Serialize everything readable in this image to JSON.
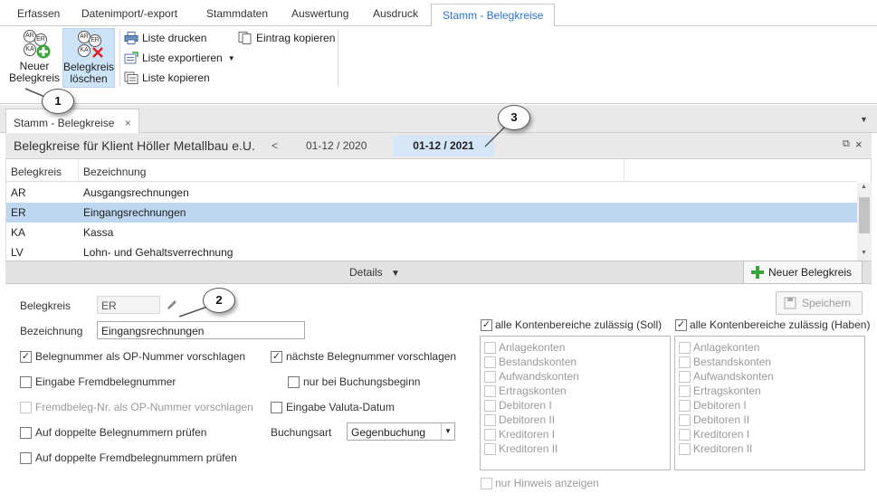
{
  "ribbon": {
    "tabs": [
      "Erfassen",
      "Datenimport/-export",
      "Stammdaten",
      "Auswertung",
      "Ausdruck",
      "Stamm - Belegkreise"
    ],
    "new_line1": "Neuer",
    "new_line2": "Belegkreis",
    "del_line1": "Belegkreis",
    "del_line2": "löschen",
    "icon_labels": [
      "AR",
      "ER",
      "KA"
    ],
    "print_list": "Liste drucken",
    "export_list": "Liste exportieren",
    "copy_list": "Liste kopieren",
    "copy_entry": "Eintrag kopieren"
  },
  "callouts": [
    "1",
    "2",
    "3"
  ],
  "doc_tab": {
    "label": "Stamm - Belegkreise",
    "close": "×"
  },
  "header": {
    "title": "Belegkreise für Klient Höller Metallbau e.U.",
    "prev": "<",
    "period_prev": "01-12 / 2020",
    "period_active": "01-12 / 2021"
  },
  "grid": {
    "columns": [
      "Belegkreis",
      "Bezeichnung"
    ],
    "rows": [
      {
        "code": "AR",
        "name": "Ausgangsrechnungen"
      },
      {
        "code": "ER",
        "name": "Eingangsrechnungen"
      },
      {
        "code": "KA",
        "name": "Kassa"
      },
      {
        "code": "LV",
        "name": "Lohn- und Gehaltsverrechnung"
      }
    ],
    "selected_index": 1
  },
  "details": {
    "label": "Details",
    "new_button": "Neuer Belegkreis",
    "save_button": "Speichern"
  },
  "form": {
    "belegkreis_label": "Belegkreis",
    "belegkreis_value": "ER",
    "bezeichnung_label": "Bezeichnung",
    "bezeichnung_value": "Eingangsrechnungen",
    "chk_op_nummer": "Belegnummer als OP-Nummer vorschlagen",
    "chk_naechste": "nächste Belegnummer vorschlagen",
    "chk_fremd": "Eingabe Fremdbelegnummer",
    "chk_buchungsbeginn": "nur bei Buchungsbeginn",
    "chk_fremd_op": "Fremdbeleg-Nr. als OP-Nummer vorschlagen",
    "chk_valuta": "Eingabe Valuta-Datum",
    "chk_doppelt": "Auf doppelte Belegnummern prüfen",
    "chk_doppelt_fremd": "Auf doppelte Fremdbelegnummern prüfen",
    "buchungsart_label": "Buchungsart",
    "buchungsart_value": "Gegenbuchung"
  },
  "soll": {
    "header": "alle Kontenbereiche zulässig (Soll)",
    "items": [
      "Anlagekonten",
      "Bestandskonten",
      "Aufwandskonten",
      "Ertragskonten",
      "Debitoren I",
      "Debitoren II",
      "Kreditoren I",
      "Kreditoren II"
    ]
  },
  "haben": {
    "header": "alle Kontenbereiche zulässig (Haben)",
    "items": [
      "Anlagekonten",
      "Bestandskonten",
      "Aufwandskonten",
      "Ertragskonten",
      "Debitoren I",
      "Debitoren II",
      "Kreditoren I",
      "Kreditoren II"
    ]
  },
  "hint_only": "nur Hinweis anzeigen",
  "colors": {
    "accent": "#2c73c9",
    "selection": "#bcd7ef",
    "active_period_bg": "#d4e6f7"
  }
}
